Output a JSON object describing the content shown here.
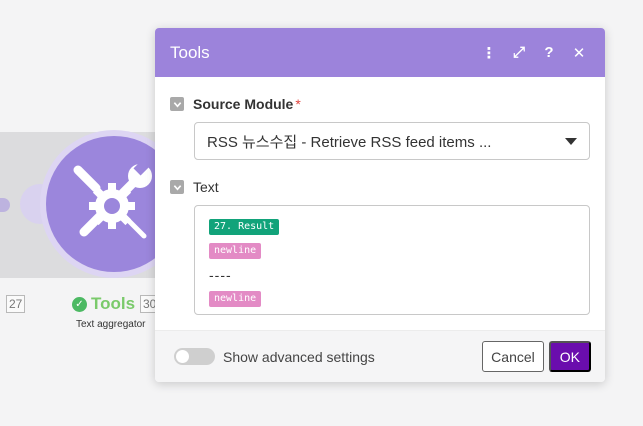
{
  "canvas": {
    "node": {
      "title": "Tools",
      "subtitle": "Text aggregator",
      "badge_left": "27",
      "badge_right": "30",
      "status_icon": "check-circle-icon",
      "module_icon": "wrench-screwdriver-gear-icon"
    }
  },
  "dialog": {
    "title": "Tools",
    "header_actions": [
      {
        "name": "more-vertical-icon",
        "glyph": "⋮"
      },
      {
        "name": "fullscreen-icon",
        "glyph": "⤢"
      },
      {
        "name": "help-icon",
        "glyph": "?"
      },
      {
        "name": "close-icon",
        "glyph": "✕"
      }
    ],
    "source_module": {
      "label": "Source Module",
      "required_mark": "*",
      "value": "RSS 뉴스수집 - Retrieve RSS feed items ..."
    },
    "text_field": {
      "label": "Text",
      "items": [
        {
          "kind": "pill",
          "color": "green",
          "text": "27. Result"
        },
        {
          "kind": "pill",
          "color": "pink",
          "text": "newline"
        },
        {
          "kind": "text",
          "text": "----"
        },
        {
          "kind": "pill",
          "color": "pink",
          "text": "newline"
        }
      ]
    },
    "footer": {
      "advanced_label": "Show advanced settings",
      "advanced_enabled": false,
      "cancel_label": "Cancel",
      "ok_label": "OK"
    }
  },
  "colors": {
    "header": "#9c83db",
    "ok_button": "#6a0dad",
    "pill_green": "#12a37a",
    "pill_pink": "#e38bc5",
    "node_title": "#7aca6b"
  }
}
